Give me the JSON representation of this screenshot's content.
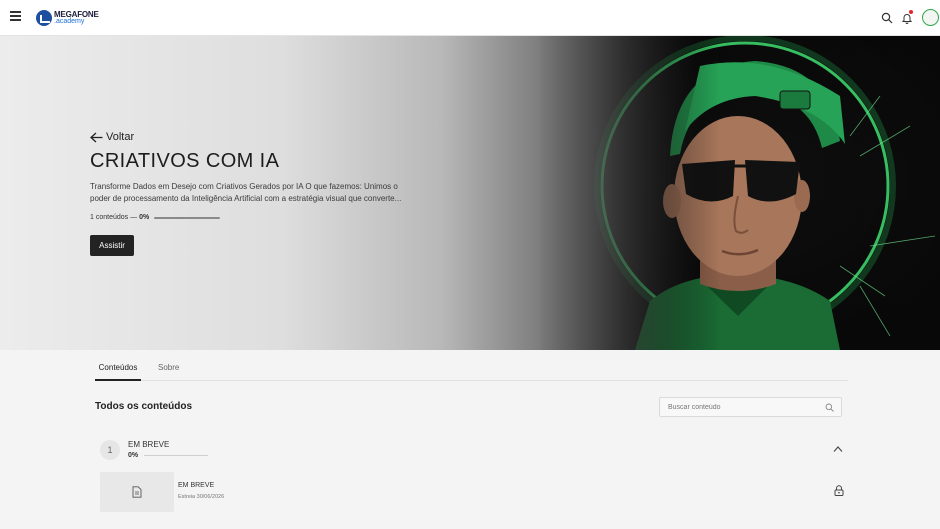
{
  "header": {
    "logo_top": "MEGAFONE",
    "logo_bottom": ".academy",
    "notification_dot_color": "#e0272d",
    "accent": "#2ea84a"
  },
  "hero": {
    "back_label": "Voltar",
    "title": "CRIATIVOS COM IA",
    "description": "Transforme Dados em Desejo com Criativos Gerados por IA O que fazemos: Unimos o poder de processamento da Inteligência Artificial com a estratégia visual que converte...",
    "contents_count": "1 conteúdos —",
    "progress_label": "0%",
    "progress": 0,
    "watch_label": "Assistir"
  },
  "tabs": [
    {
      "label": "Conteúdos",
      "active": true
    },
    {
      "label": "Sobre",
      "active": false
    }
  ],
  "section": {
    "title": "Todos os conteúdos",
    "search_placeholder": "Buscar conteúdo"
  },
  "module": {
    "number": "1",
    "title": "EM BREVE",
    "progress_label": "0%",
    "progress": 0,
    "lessons": [
      {
        "title": "EM BREVE",
        "date": "Estreia 30/06/2026",
        "locked": true,
        "icon": "document-icon"
      }
    ]
  }
}
